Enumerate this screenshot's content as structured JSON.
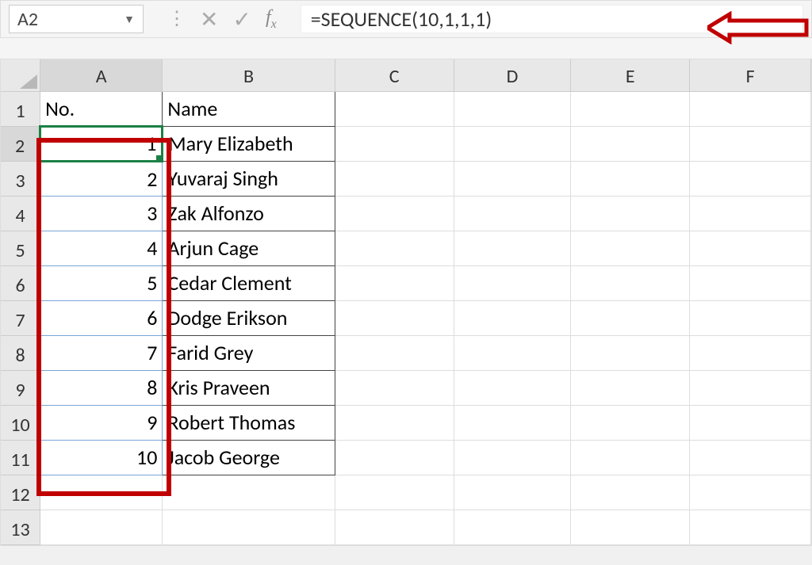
{
  "name_box": "A2",
  "formula": "=SEQUENCE(10,1,1,1)",
  "columns": [
    "A",
    "B",
    "C",
    "D",
    "E",
    "F"
  ],
  "rows": [
    "1",
    "2",
    "3",
    "4",
    "5",
    "6",
    "7",
    "8",
    "9",
    "10",
    "11",
    "12",
    "13"
  ],
  "headers": {
    "no": "No.",
    "name": "Name"
  },
  "data": [
    {
      "no": "1",
      "name": "Mary Elizabeth"
    },
    {
      "no": "2",
      "name": "Yuvaraj Singh"
    },
    {
      "no": "3",
      "name": "Zak Alfonzo"
    },
    {
      "no": "4",
      "name": "Arjun Cage"
    },
    {
      "no": "5",
      "name": "Cedar Clement"
    },
    {
      "no": "6",
      "name": "Dodge Erikson"
    },
    {
      "no": "7",
      "name": "Farid Grey"
    },
    {
      "no": "8",
      "name": "Kris Praveen"
    },
    {
      "no": "9",
      "name": "Robert Thomas"
    },
    {
      "no": "10",
      "name": "Jacob George"
    }
  ],
  "selected_column": "A",
  "selected_row": "2",
  "annotation_color": "#c00000"
}
